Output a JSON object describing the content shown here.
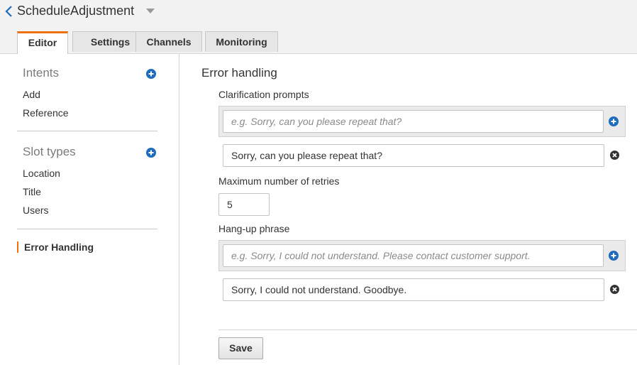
{
  "header": {
    "bot_name": "ScheduleAdjustment",
    "tabs": [
      {
        "label": "Editor"
      },
      {
        "label": "Settings"
      },
      {
        "label": "Channels"
      },
      {
        "label": "Monitoring"
      }
    ],
    "active_tab": "Editor"
  },
  "sidebar": {
    "intents_heading": "Intents",
    "intents": [
      "Add",
      "Reference"
    ],
    "slot_types_heading": "Slot types",
    "slot_types": [
      "Location",
      "Title",
      "Users"
    ],
    "active_item": "Error Handling"
  },
  "main": {
    "section_title": "Error handling",
    "clarification": {
      "label": "Clarification prompts",
      "new_placeholder": "e.g. Sorry, can you please repeat that?",
      "prompts": [
        "Sorry, can you please repeat that?"
      ]
    },
    "retries": {
      "label": "Maximum number of retries",
      "value": "5"
    },
    "hangup": {
      "label": "Hang-up phrase",
      "new_placeholder": "e.g. Sorry, I could not understand. Please contact customer support.",
      "phrases": [
        "Sorry, I could not understand. Goodbye."
      ]
    },
    "save_label": "Save"
  },
  "colors": {
    "accent_orange": "#ec7211",
    "link_blue": "#1f6bbd",
    "remove_dark": "#333333"
  }
}
